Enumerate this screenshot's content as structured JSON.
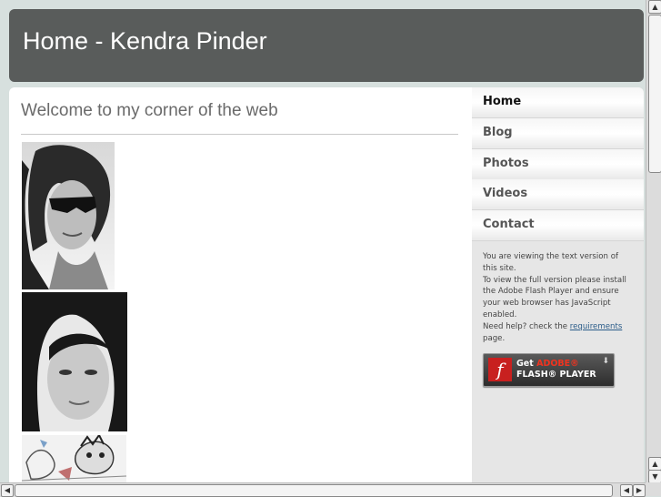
{
  "header": {
    "title": "Home - Kendra Pinder"
  },
  "main": {
    "heading": "Welcome to my corner of the web"
  },
  "photos": [
    {
      "name": "portrait-sunglasses-photo"
    },
    {
      "name": "portrait-closeup-photo"
    },
    {
      "name": "cartoon-sketch-photo"
    }
  ],
  "nav": {
    "items": [
      {
        "label": "Home"
      },
      {
        "label": "Blog"
      },
      {
        "label": "Photos"
      },
      {
        "label": "Videos"
      },
      {
        "label": "Contact"
      }
    ]
  },
  "notice": {
    "line1": "You are viewing the text version of this site.",
    "line2": "To view the full version please install the Adobe Flash Player and ensure your web browser has JavaScript enabled.",
    "line3_prefix": "Need help? check the",
    "link": "requirements",
    "line3_suffix": "page."
  },
  "flash_badge": {
    "get": "Get",
    "adobe": "ADOBE®",
    "product": "FLASH® PLAYER"
  },
  "colors": {
    "header_bg": "#595c5b",
    "page_bg": "#d7e0de",
    "flash_red": "#c8201f"
  }
}
